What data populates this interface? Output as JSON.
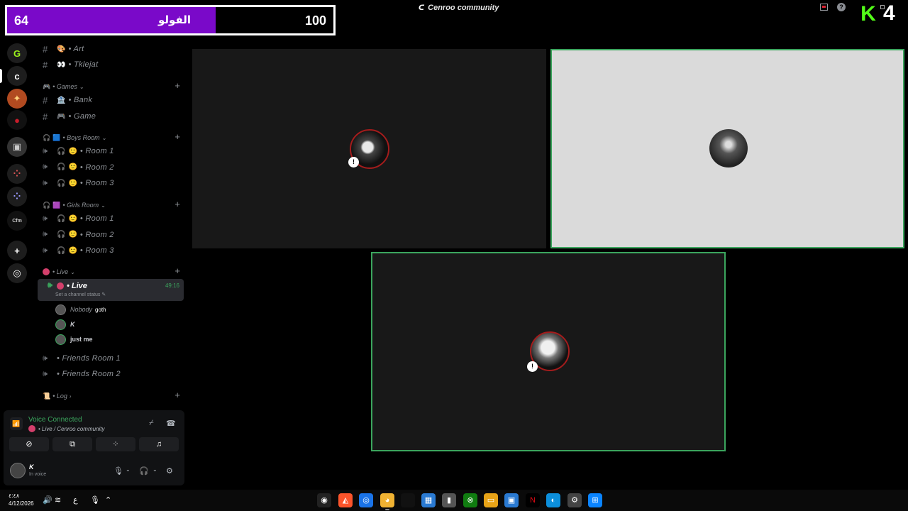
{
  "overlay": {
    "follower_current": "64",
    "follower_label": "الفولو",
    "follower_goal": "100",
    "follower_progress": 0.64,
    "follower_fill_color": "#7a09c9",
    "badge_number": "4",
    "logo_letter": "K",
    "logo_color": "#53fc18"
  },
  "window": {
    "title": "Cenroo community",
    "title_icon": "c-logo-icon",
    "help_label": "?"
  },
  "rail": {
    "servers": [
      {
        "name": "server-cenroo-green",
        "glyph": "G",
        "color": "#1d1d1d",
        "fg": "#9bf21c"
      },
      {
        "name": "server-cenroo",
        "glyph": "c",
        "color": "#1d1d1d",
        "fg": "#fff",
        "active": true
      },
      {
        "name": "server-fire",
        "glyph": "✦",
        "color": "#b14a20",
        "fg": "#ffd27a"
      },
      {
        "name": "server-red",
        "glyph": "●",
        "color": "#111",
        "fg": "#c91d2b"
      },
      {
        "name": "server-gray",
        "glyph": "▣",
        "color": "#333",
        "fg": "#ccc"
      },
      {
        "name": "server-folder-1",
        "glyph": "⁘",
        "color": "#1d1d1d",
        "fg": "#d55"
      },
      {
        "name": "server-folder-2",
        "glyph": "⁘",
        "color": "#1d1d1d",
        "fg": "#99f"
      },
      {
        "name": "server-cfm",
        "glyph": "Cfm",
        "color": "#111",
        "fg": "#ccc"
      }
    ],
    "add_icon": "+",
    "discover_icon": "◎"
  },
  "sidebar": {
    "text_channels": [
      {
        "emoji": "🎨",
        "name": "• Art"
      },
      {
        "emoji": "👀",
        "name": "• Tklejat"
      }
    ],
    "games_category": "• Games",
    "games_channels": [
      {
        "emoji": "🏦",
        "name": "• Bank"
      },
      {
        "emoji": "🎮",
        "name": "• Game"
      }
    ],
    "boys_category": "• Boys Room",
    "boys_rooms": [
      "• Room 1",
      "• Room 2",
      "• Room 3"
    ],
    "girls_category": "• Girls Room",
    "girls_rooms": [
      "• Room 1",
      "• Room 2",
      "• Room 3"
    ],
    "live_category": "• Live",
    "live_channel": {
      "name": "• Live",
      "timer": "49:16",
      "status_placeholder": "Set a channel status"
    },
    "voice_users": [
      {
        "name": "Nobody",
        "tag": "goth"
      },
      {
        "name": "K",
        "tag": ""
      },
      {
        "name": "just me",
        "tag": ""
      }
    ],
    "friends_rooms": [
      "• Friends Room 1",
      "• Friends Room 2"
    ],
    "log_category": "• Log"
  },
  "voice_panel": {
    "status": "Voice Connected",
    "location": "• Live / Cenroo community",
    "user_name": "K",
    "user_status": "In voice"
  },
  "stage": {
    "tiles": [
      {
        "speaking": false
      },
      {
        "speaking": true
      },
      {
        "speaking": true
      }
    ]
  },
  "taskbar": {
    "time": "٤:٤٨",
    "date": "4/12/2026",
    "lang": "ع"
  }
}
